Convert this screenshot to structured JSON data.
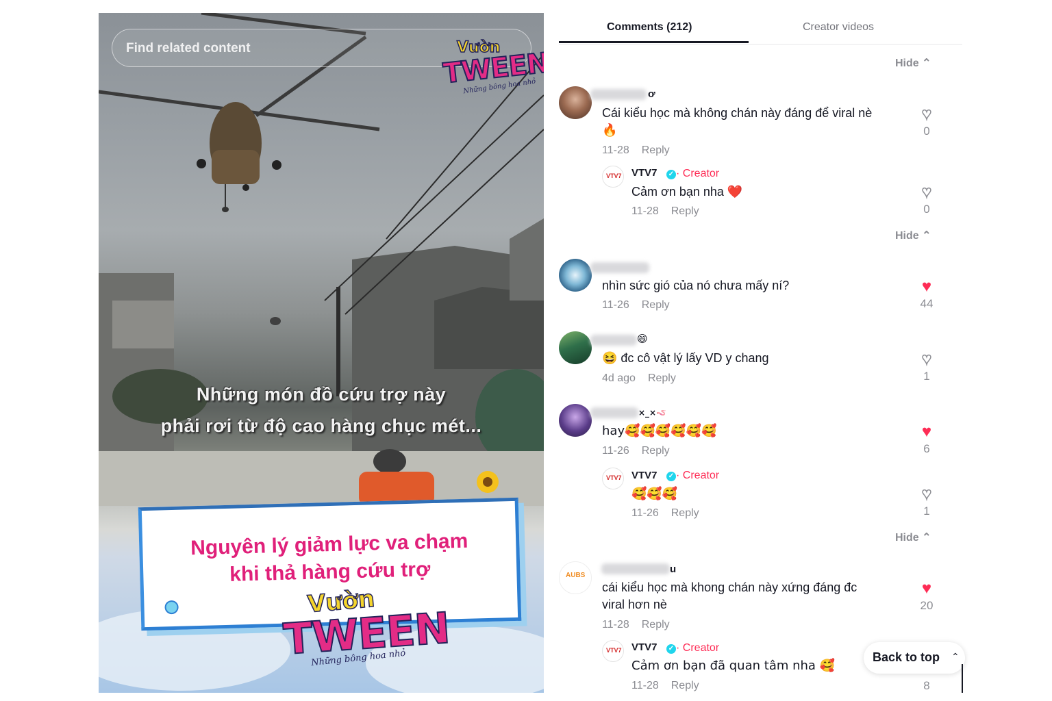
{
  "video": {
    "search_placeholder": "Find related content",
    "caption_line1": "Những món đồ cứu trợ này",
    "caption_line2": "phải rơi từ độ cao hàng chục mét...",
    "card_line1": "Nguyên lý giảm lực va chạm",
    "card_line2": "khi thả hàng cứu trợ",
    "logo_top": "Vườn",
    "logo_main": "TWEEN",
    "logo_sub": "Những bông hoa nhỏ"
  },
  "tabs": {
    "comments": "Comments (212)",
    "creator_videos": "Creator videos"
  },
  "labels": {
    "hide": "Hide",
    "reply": "Reply",
    "creator": "Creator",
    "back_to_top": "Back to top"
  },
  "comments": [
    {
      "name_suffix": "ơ",
      "text_l1": "Cái kiểu học mà không chán này đáng để viral nè",
      "text_l2": "🔥",
      "date": "11-28",
      "likes": "0",
      "reply": {
        "name": "VTV7",
        "text": "Cảm ơn bạn nha ❤️",
        "date": "11-28",
        "likes": "0"
      }
    },
    {
      "text_l1": "nhìn sức gió của nó chưa mấy ní?",
      "date": "11-26",
      "likes": "44"
    },
    {
      "name_suffix": "😄",
      "text_l1": "😆 đc cô vật lý lấy VD y chang",
      "date": "4d ago",
      "likes": "1"
    },
    {
      "name_suffix": "×_×🪱",
      "text_l1": "hay🥰🥰🥰🥰🥰🥰",
      "date": "11-26",
      "likes": "6",
      "reply": {
        "name": "VTV7",
        "text": "🥰🥰🥰",
        "date": "11-26",
        "likes": "1"
      }
    },
    {
      "name_suffix": "u",
      "text_l1": "cái kiểu học mà khong chán này xứng đáng đc",
      "text_l2": "viral hơn nè",
      "date": "11-28",
      "likes": "20",
      "reply": {
        "name": "VTV7",
        "text": "Cảm ơn bạn đã quan tâm nha 🥰",
        "date": "11-28",
        "likes": "8"
      }
    }
  ]
}
